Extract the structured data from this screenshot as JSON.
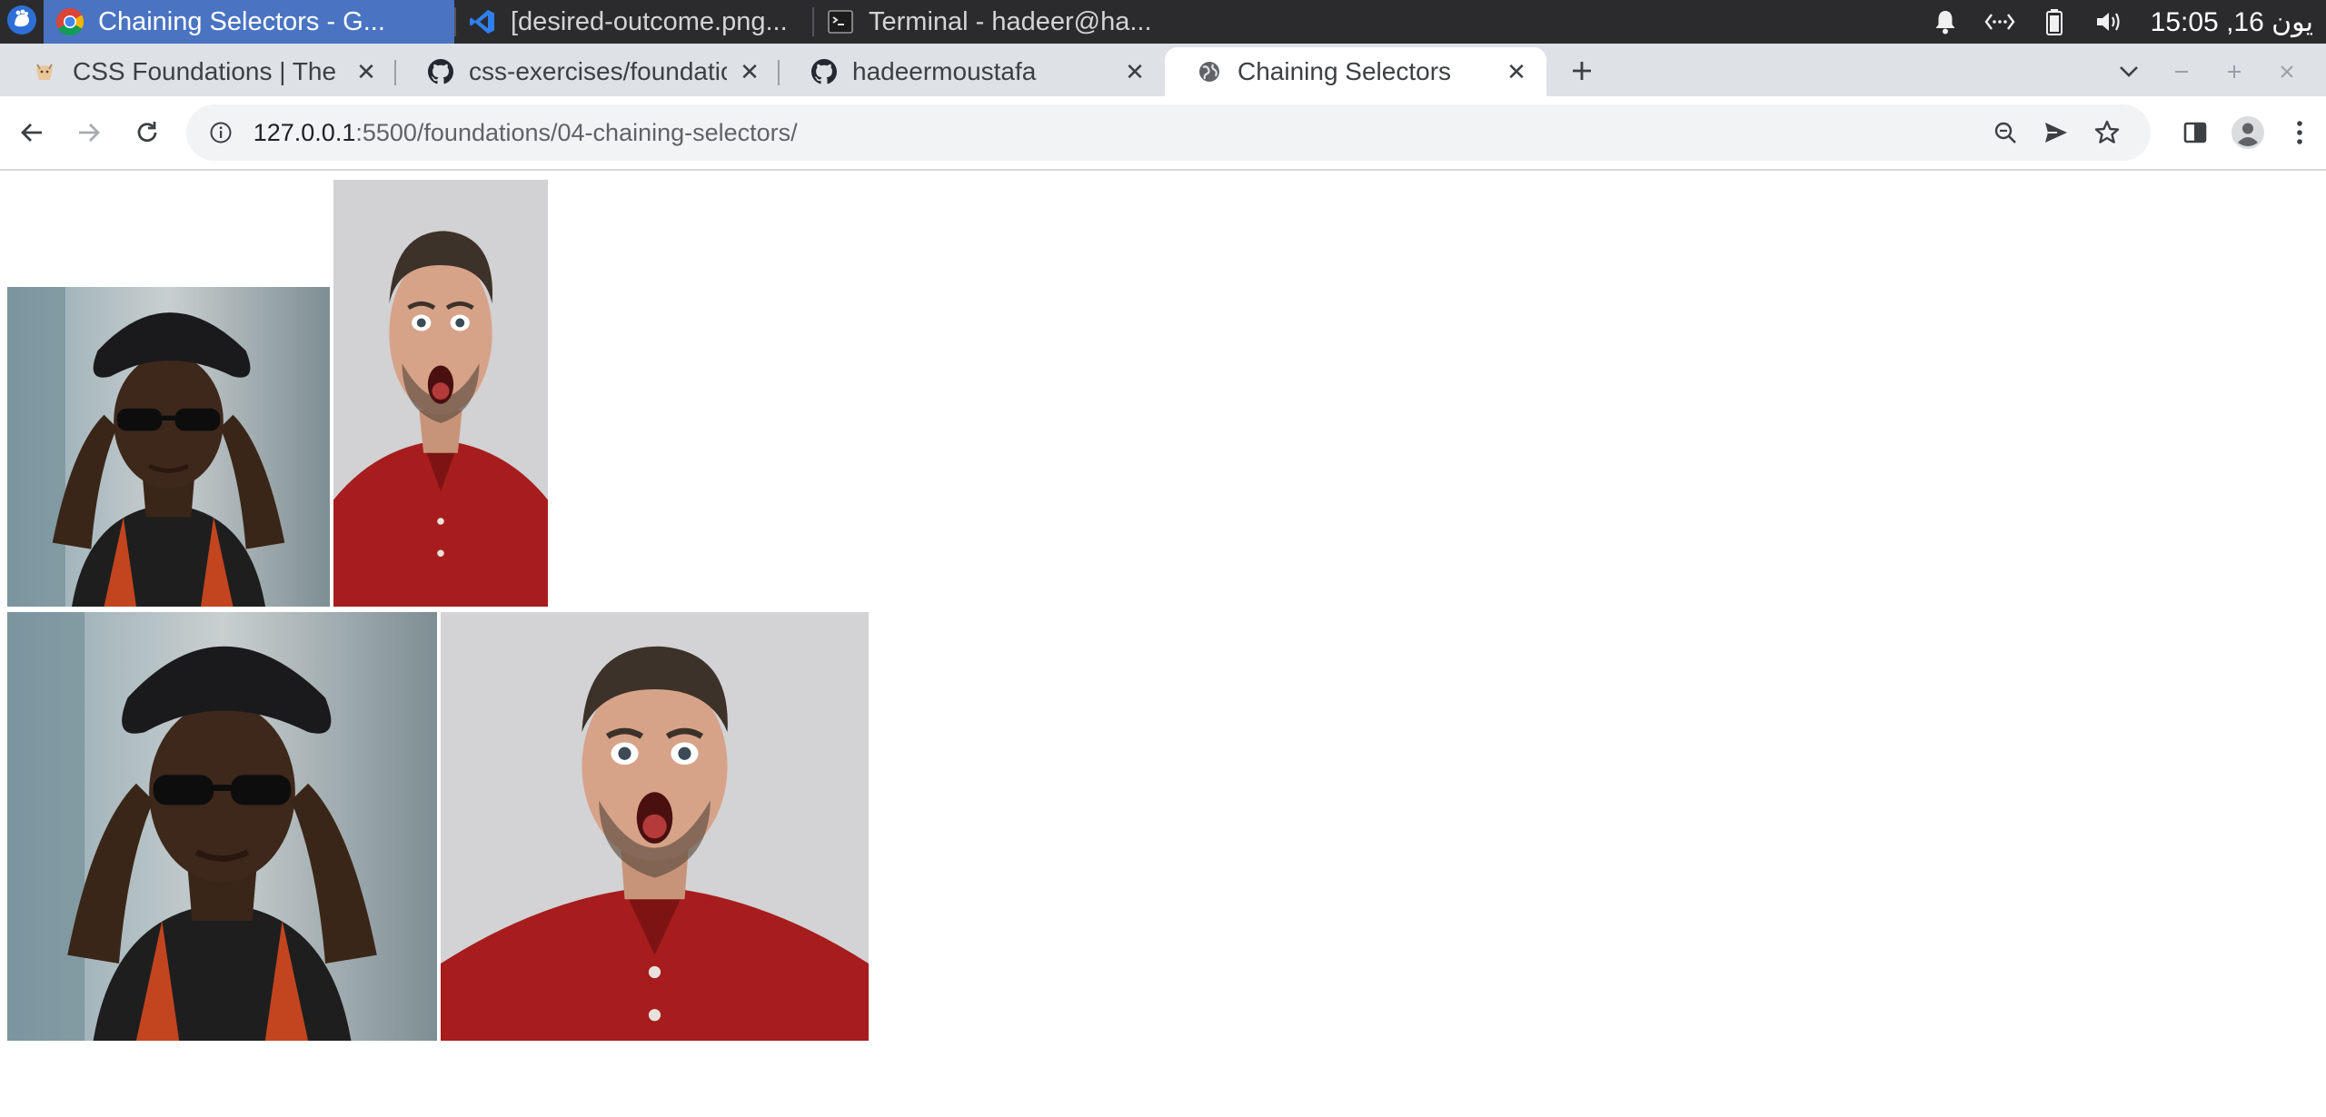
{
  "desktop_panel": {
    "tasks": [
      {
        "label": "Chaining Selectors - G...",
        "icon": "chrome-icon",
        "active": true
      },
      {
        "label": "[desired-outcome.png...",
        "icon": "vscode-icon",
        "active": false
      },
      {
        "label": "Terminal - hadeer@ha...",
        "icon": "terminal-icon",
        "active": false
      }
    ],
    "clock": "15:05 ,16 يون"
  },
  "browser": {
    "tabs": [
      {
        "label": "CSS Foundations | The",
        "icon": "odin-icon",
        "active": false
      },
      {
        "label": "css-exercises/foundatio",
        "icon": "github-icon",
        "active": false
      },
      {
        "label": "hadeermoustafa",
        "icon": "github-icon",
        "active": false
      },
      {
        "label": "Chaining Selectors",
        "icon": "globe-icon",
        "active": true
      }
    ],
    "url_host": "127.0.0.1",
    "url_path": ":5500/foundations/04-chaining-selectors/"
  },
  "page": {
    "images": [
      {
        "subject": "woman-with-sunglasses",
        "row": 1
      },
      {
        "subject": "surprised-man",
        "row": 1
      },
      {
        "subject": "woman-with-sunglasses",
        "row": 2
      },
      {
        "subject": "surprised-man",
        "row": 2
      }
    ]
  },
  "colors": {
    "panel_bg": "#2b2b2e",
    "panel_active": "#4a74c2",
    "tabstrip_bg": "#dee1e6",
    "omnibox_bg": "#f1f3f4"
  }
}
